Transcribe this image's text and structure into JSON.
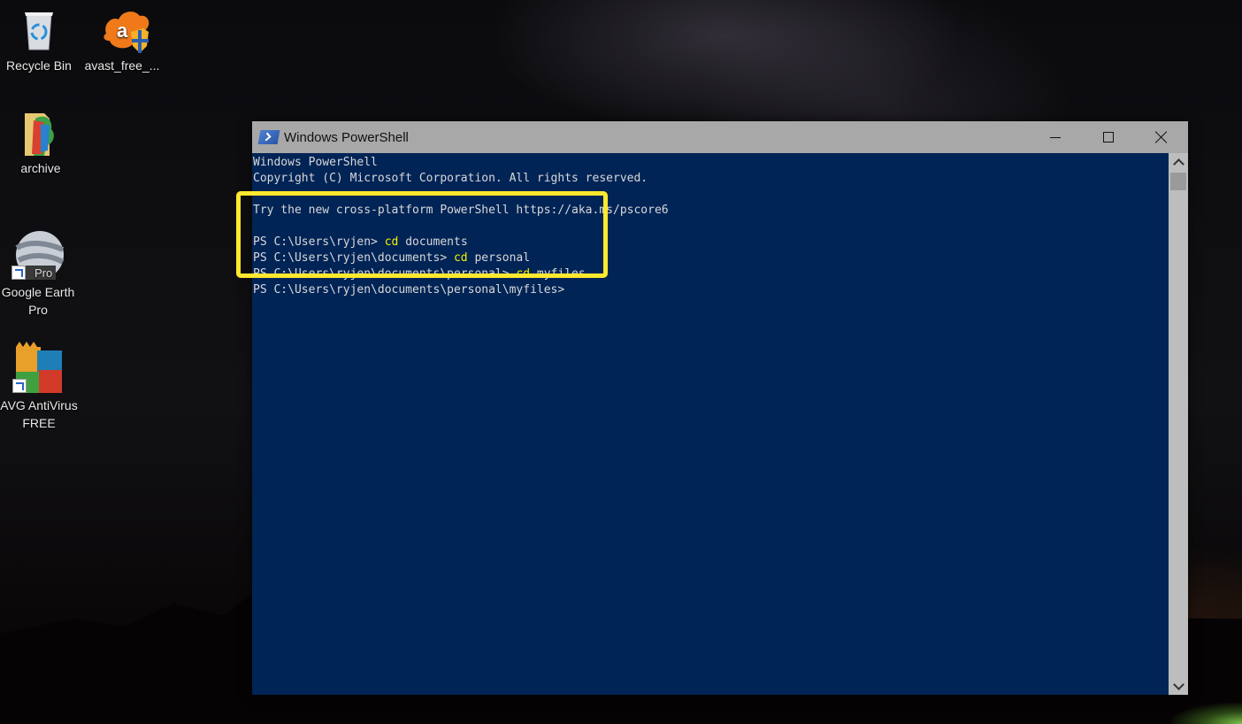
{
  "desktop": {
    "icons": [
      {
        "label": "Recycle Bin",
        "icon": "recycle-bin-icon"
      },
      {
        "label": "avast_free_...",
        "icon": "avast-icon"
      },
      {
        "label": "archive",
        "icon": "folder-icon"
      },
      {
        "label": "Google Earth Pro",
        "icon": "google-earth-icon",
        "badge": "Pro"
      },
      {
        "label": "AVG AntiVirus FREE",
        "icon": "avg-icon"
      }
    ]
  },
  "window": {
    "title": "Windows PowerShell",
    "controls": {
      "minimize": "minimize",
      "maximize": "maximize",
      "close": "close"
    },
    "colors": {
      "console_bg": "#012456",
      "highlight": "#ffe82e",
      "command": "#f2f200"
    }
  },
  "console": {
    "header": [
      "Windows PowerShell",
      "Copyright (C) Microsoft Corporation. All rights reserved.",
      "",
      "Try the new cross-platform PowerShell https://aka.ms/pscore6",
      ""
    ],
    "commands": [
      {
        "prompt": "PS C:\\Users\\ryjen> ",
        "cmd": "cd",
        "arg": " documents"
      },
      {
        "prompt": "PS C:\\Users\\ryjen\\documents> ",
        "cmd": "cd",
        "arg": " personal"
      },
      {
        "prompt": "PS C:\\Users\\ryjen\\documents\\personal> ",
        "cmd": "cd",
        "arg": " myfiles"
      },
      {
        "prompt": "PS C:\\Users\\ryjen\\documents\\personal\\myfiles>",
        "cmd": "",
        "arg": ""
      }
    ]
  }
}
